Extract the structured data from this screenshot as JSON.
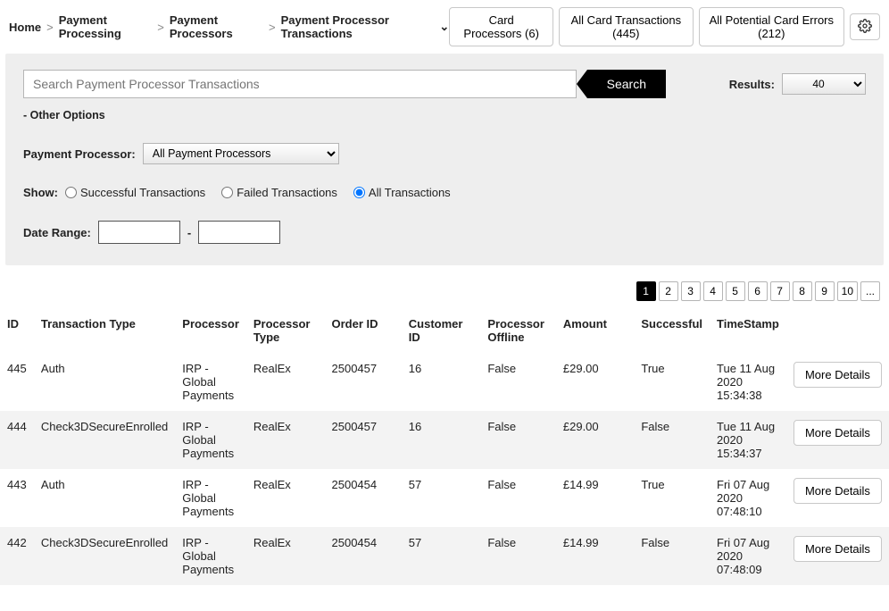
{
  "breadcrumb": {
    "home": "Home",
    "sep": ">",
    "l1": "Payment Processing",
    "l2": "Payment Processors",
    "l3": "Payment Processor Transactions"
  },
  "topbuttons": {
    "card_processors": "Card Processors (6)",
    "all_card_transactions": "All Card Transactions (445)",
    "all_potential_errors": "All Potential Card Errors (212)"
  },
  "search": {
    "placeholder": "Search Payment Processor Transactions",
    "button": "Search"
  },
  "results": {
    "label": "Results:",
    "value": "40"
  },
  "other_options": "- Other Options",
  "processor_filter": {
    "label": "Payment Processor:",
    "value": "All Payment Processors"
  },
  "show_filter": {
    "label": "Show:",
    "opt_success": "Successful Transactions",
    "opt_failed": "Failed Transactions",
    "opt_all": "All Transactions",
    "selected": "all"
  },
  "date_range": {
    "label": "Date Range:",
    "sep": "-"
  },
  "pagination": [
    "1",
    "2",
    "3",
    "4",
    "5",
    "6",
    "7",
    "8",
    "9",
    "10",
    "..."
  ],
  "columns": {
    "id": "ID",
    "ttype": "Transaction Type",
    "processor": "Processor",
    "ptype": "Processor Type",
    "orderid": "Order ID",
    "custid": "Customer ID",
    "offline": "Processor Offline",
    "amount": "Amount",
    "success": "Successful",
    "timestamp": "TimeStamp"
  },
  "more_details": "More Details",
  "rows": [
    {
      "id": "445",
      "ttype": "Auth",
      "processor": "IRP - Global Payments",
      "ptype": "RealEx",
      "orderid": "2500457",
      "custid": "16",
      "offline": "False",
      "amount": "£29.00",
      "success": "True",
      "timestamp": "Tue 11 Aug 2020 15:34:38"
    },
    {
      "id": "444",
      "ttype": "Check3DSecureEnrolled",
      "processor": "IRP - Global Payments",
      "ptype": "RealEx",
      "orderid": "2500457",
      "custid": "16",
      "offline": "False",
      "amount": "£29.00",
      "success": "False",
      "timestamp": "Tue 11 Aug 2020 15:34:37"
    },
    {
      "id": "443",
      "ttype": "Auth",
      "processor": "IRP - Global Payments",
      "ptype": "RealEx",
      "orderid": "2500454",
      "custid": "57",
      "offline": "False",
      "amount": "£14.99",
      "success": "True",
      "timestamp": "Fri 07 Aug 2020 07:48:10"
    },
    {
      "id": "442",
      "ttype": "Check3DSecureEnrolled",
      "processor": "IRP - Global Payments",
      "ptype": "RealEx",
      "orderid": "2500454",
      "custid": "57",
      "offline": "False",
      "amount": "£14.99",
      "success": "False",
      "timestamp": "Fri 07 Aug 2020 07:48:09"
    }
  ]
}
